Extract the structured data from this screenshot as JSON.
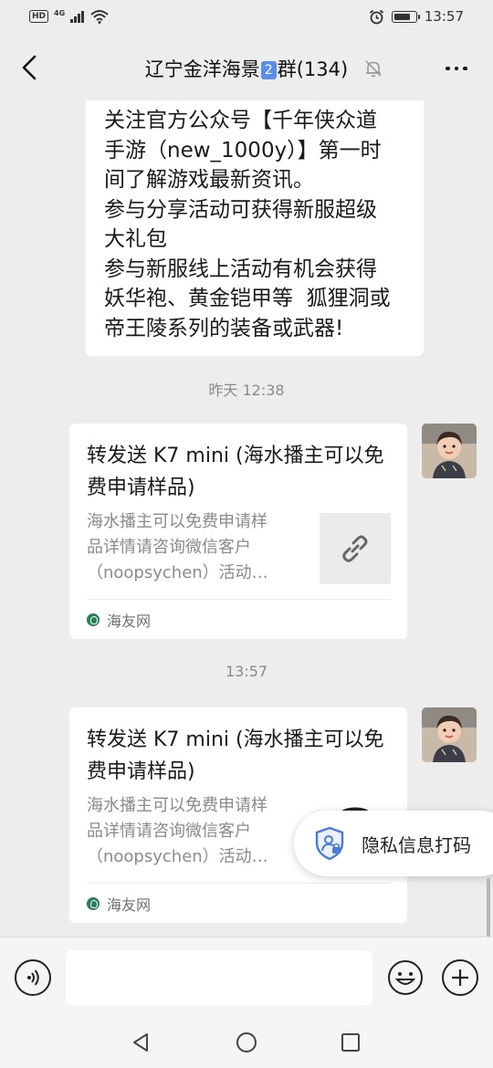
{
  "status_bar": {
    "left_badge": "HD",
    "network": "4G",
    "time": "13:57",
    "battery_level": 0.8
  },
  "nav": {
    "title_prefix": "辽宁金洋海景",
    "title_badge": "2",
    "title_suffix": "群(134)",
    "icons": {
      "back": "chevron-left-icon",
      "mute": "bell-muted-icon",
      "more": "more-dots-icon"
    }
  },
  "messages": {
    "text_bubble_lines": [
      "关注官方公众号【千年侠众道",
      "手游（new_1000y）】第一时",
      "间了解游戏最新资讯。",
      "参与分享活动可获得新服超级",
      "大礼包",
      "参与新服线上活动有机会获得",
      "妖华袍、黄金铠甲等  狐狸洞或",
      "帝王陵系列的装备或武器!"
    ],
    "time_1": "昨天 12:38",
    "card_1": {
      "title": "转发送 K7 mini (海水播主可以免费申请样品)",
      "desc_lines": [
        "海水播主可以免费申请样",
        "品详情请咨询微信客户",
        "（noopsychen）活动…"
      ],
      "source": "海友网",
      "thumb_icon": "link-icon"
    },
    "time_2": "13:57",
    "card_2": {
      "title": "转发送 K7 mini (海水播主可以免费申请样品)",
      "desc_lines": [
        "海水播主可以免费申请样",
        "品详情请咨询微信客户",
        "（noopsychen）活动…"
      ],
      "source": "海友网",
      "thumb_icon": "headphones-thumb-icon"
    }
  },
  "privacy_popup": {
    "label": "隐私信息打码",
    "icon": "shield-privacy-icon"
  },
  "input_bar": {
    "placeholder": "",
    "icons": {
      "voice": "voice-icon",
      "emoji": "emoji-icon",
      "plus": "plus-icon"
    }
  },
  "system_nav": {
    "icons": {
      "back": "triangle-back-icon",
      "home": "circle-home-icon",
      "recents": "square-recents-icon"
    }
  },
  "colors": {
    "background": "#ededed",
    "bubble": "#ffffff",
    "badge": "#5b8ee8",
    "source_icon": "#2a7f5b"
  }
}
